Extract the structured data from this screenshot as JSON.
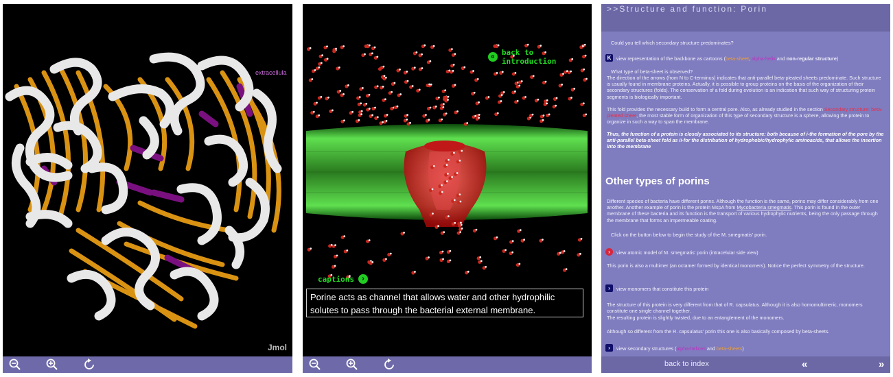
{
  "panel1": {
    "label_extracellular": "extracellula",
    "jmol_label": "Jmol",
    "toolbar": [
      "zoom-out-icon",
      "zoom-in-icon",
      "reset-rotate-icon"
    ]
  },
  "panel2": {
    "back_to_intro": "back to introduction",
    "captions": "captions",
    "caption_text": "Porine acts as channel that allows water and other hydrophilic solutes to pass  through the bacterial external membrane.",
    "toolbar": [
      "zoom-out-icon",
      "zoom-in-icon",
      "reset-rotate-icon"
    ]
  },
  "panel3": {
    "title": ">>Structure and function: Porin",
    "q1": "Could you tell which secondary structure predominates?",
    "link1_pre": "view representation of the backbone as cartoons (",
    "link1_beta": "beta-sheet",
    "link1_comma": ", ",
    "link1_alpha": "alpha-helix",
    "link1_and": " and ",
    "link1_nonreg": "non-regular structure",
    "link1_end": ")",
    "q2": "What type of beta-sheet is observed?",
    "para1": "The direction of the arrows (from N to C-terminus) indicates that anti-parallel beta-pleated sheets predominate. Such structure is usually found in membrane proteins. Actually, it is possible to group proteins on the basis of the organization of their secondary structures (folds). The conservation of a fold during evolution is an indication that such way of structuring protein segments is biologically important.",
    "para2_pre": "This fold provides the necessary build to form a central pore. Also, as already studied in the section ",
    "para2_link": "Secondary structure: beta-pleated sheet",
    "para2_post": ", the most stable form of organization of this type of secondary structure is a sphere, allowing the protein to organize in such a way to span the membrane.",
    "para3": "Thus, the function of a protein is closely associated to its structure: both because of i-the formation of the pore by the anti-parallel beta-sheet fold as ii-for the distribution of hydrophobic/hydrophylic aminoacids, that allows the insertion into the membrane",
    "section_head": "Other types of porins",
    "para4_pre": "Different species of bacteria have different porins. Although the function is the same, porins may differ considerably from one another. Another example of porin is the protein MspA from ",
    "para4_link": "Mycobacteria smegmatis",
    "para4_post": ". This porin is found in the outer membrane of these bacteria and its function is the transport of various hydrophylic nutrients, being the only passage through the membrane that forms an impermeable coating.",
    "para5": "Click on the button below to begin the study of the M. smegmatis' porin.",
    "link2": "view atomic model of M. smegmatis' porin (intracelular side view)",
    "para6": "This porin is also a multimer (an octamer formed by identical monomers). Notice the perfect symmetry of the structure.",
    "link3": "view monomers that constitute this protein",
    "para7": "The structure of this protein is very different from that of R. capsulatus. Although it is also homomultimeric, monomers constitute one single channel together.",
    "para8": "The resulting protein is slightly twisted, due to an entanglement of the monomers.",
    "para9": "Although so different from the R. capsulatus' porin this one is also basically composed by beta-sheets.",
    "link4_pre": "view secondary structures (",
    "link4_alpha": "alpha-helices",
    "link4_and": " and ",
    "link4_beta": "beta-sheets",
    "link4_end": ")",
    "back_to_index": "back to index",
    "prev": "«",
    "next": "»"
  },
  "colors": {
    "panel_bg": "#7f7cbf",
    "header_bg": "#6c68a6",
    "green_accent": "#22dd22",
    "beta_sheet": "#f0a030",
    "alpha_helix": "#c030c0"
  }
}
